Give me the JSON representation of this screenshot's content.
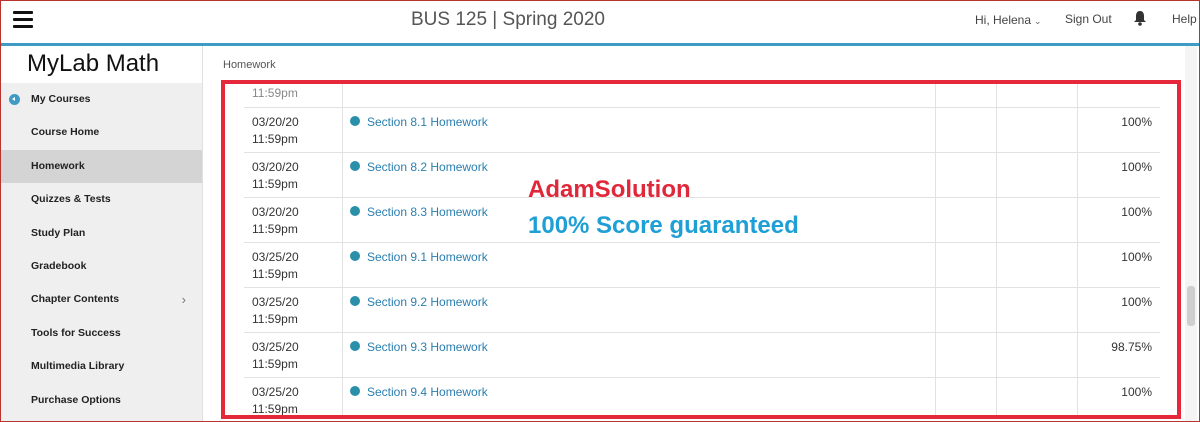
{
  "header": {
    "course_title": "BUS 125 | Spring 2020",
    "greeting": "Hi, Helena",
    "sign_out": "Sign Out",
    "help": "Help"
  },
  "sidebar": {
    "brand": "MyLab Math",
    "items": [
      {
        "label": "My Courses"
      },
      {
        "label": "Course Home"
      },
      {
        "label": "Homework"
      },
      {
        "label": "Quizzes & Tests"
      },
      {
        "label": "Study Plan"
      },
      {
        "label": "Gradebook"
      },
      {
        "label": "Chapter Contents"
      },
      {
        "label": "Tools for Success"
      },
      {
        "label": "Multimedia Library"
      },
      {
        "label": "Purchase Options"
      }
    ]
  },
  "breadcrumb": "Homework",
  "partial_row_time": "11:59pm",
  "assignments": [
    {
      "date": "03/20/20",
      "time": "11:59pm",
      "name": "Section 8.1 Homework",
      "score": "100%"
    },
    {
      "date": "03/20/20",
      "time": "11:59pm",
      "name": "Section 8.2 Homework",
      "score": "100%"
    },
    {
      "date": "03/20/20",
      "time": "11:59pm",
      "name": "Section 8.3 Homework",
      "score": "100%"
    },
    {
      "date": "03/25/20",
      "time": "11:59pm",
      "name": "Section 9.1 Homework",
      "score": "100%"
    },
    {
      "date": "03/25/20",
      "time": "11:59pm",
      "name": "Section 9.2 Homework",
      "score": "100%"
    },
    {
      "date": "03/25/20",
      "time": "11:59pm",
      "name": "Section 9.3 Homework",
      "score": "98.75%"
    },
    {
      "date": "03/25/20",
      "time": "11:59pm",
      "name": "Section 9.4 Homework",
      "score": "100%"
    }
  ],
  "overlay": {
    "title": "AdamSolution",
    "subtitle": "100% Score guaranteed"
  },
  "colors": {
    "accent": "#3f9bc4",
    "highlight_border": "#e5283a",
    "link": "#2a7fb0",
    "overlay_title": "#e0283a",
    "overlay_subtitle": "#1e9fd6"
  },
  "icons": {
    "menu": "hamburger-menu-icon",
    "notifications": "bell-icon",
    "back": "back-arrow-icon",
    "expand": "chevron-right-icon",
    "status": "status-dot-icon"
  }
}
